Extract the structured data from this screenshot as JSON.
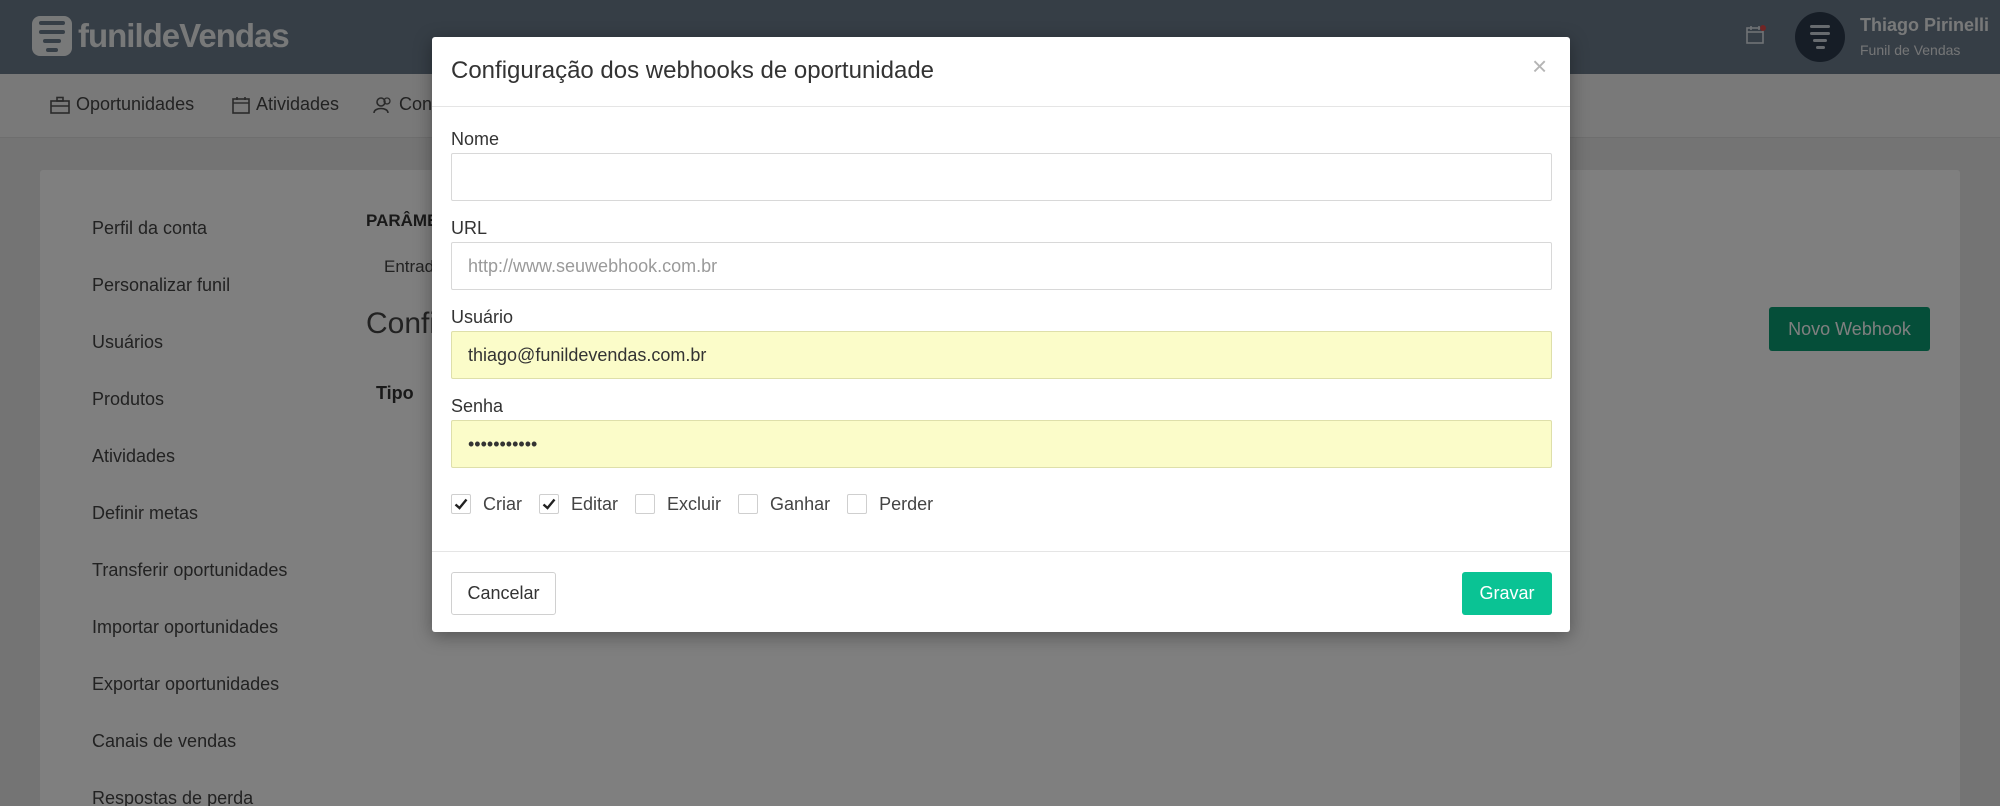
{
  "app": {
    "logo_text": "funildeVendas",
    "user_name": "Thiago Pirinelli",
    "user_company": "Funil de Vendas"
  },
  "nav": {
    "items": [
      {
        "label": "Oportunidades",
        "icon": "briefcase-icon"
      },
      {
        "label": "Atividades",
        "icon": "calendar-icon"
      },
      {
        "label": "Cont",
        "icon": "contacts-icon"
      }
    ]
  },
  "sidebar": {
    "items": [
      {
        "label": "Perfil da conta"
      },
      {
        "label": "Personalizar funil"
      },
      {
        "label": "Usuários"
      },
      {
        "label": "Produtos"
      },
      {
        "label": "Atividades"
      },
      {
        "label": "Definir metas"
      },
      {
        "label": "Transferir oportunidades"
      },
      {
        "label": "Importar oportunidades"
      },
      {
        "label": "Exportar oportunidades"
      },
      {
        "label": "Canais de vendas"
      },
      {
        "label": "Respostas de perda"
      }
    ]
  },
  "background": {
    "params_heading": "PARÂME",
    "tab_label": "Entrad",
    "section_heading": "Config",
    "column_tipo": "Tipo",
    "new_webhook_label": "Novo Webhook"
  },
  "modal": {
    "title": "Configuração dos webhooks de oportunidade",
    "close_glyph": "×",
    "nome": {
      "label": "Nome",
      "value": "",
      "placeholder": ""
    },
    "url": {
      "label": "URL",
      "value": "",
      "placeholder": "http://www.seuwebhook.com.br"
    },
    "usuario": {
      "label": "Usuário",
      "value": "thiago@funildevendas.com.br"
    },
    "senha": {
      "label": "Senha",
      "value": "•••••••••••"
    },
    "events": [
      {
        "label": "Criar",
        "checked": true
      },
      {
        "label": "Editar",
        "checked": true
      },
      {
        "label": "Excluir",
        "checked": false
      },
      {
        "label": "Ganhar",
        "checked": false
      },
      {
        "label": "Perder",
        "checked": false
      }
    ],
    "cancel_label": "Cancelar",
    "save_label": "Gravar"
  },
  "colors": {
    "topbar": "#6d7c8c",
    "save_button": "#0ac394",
    "new_webhook_button": "#0b9c73",
    "autofill_field": "#fbfcc9"
  }
}
